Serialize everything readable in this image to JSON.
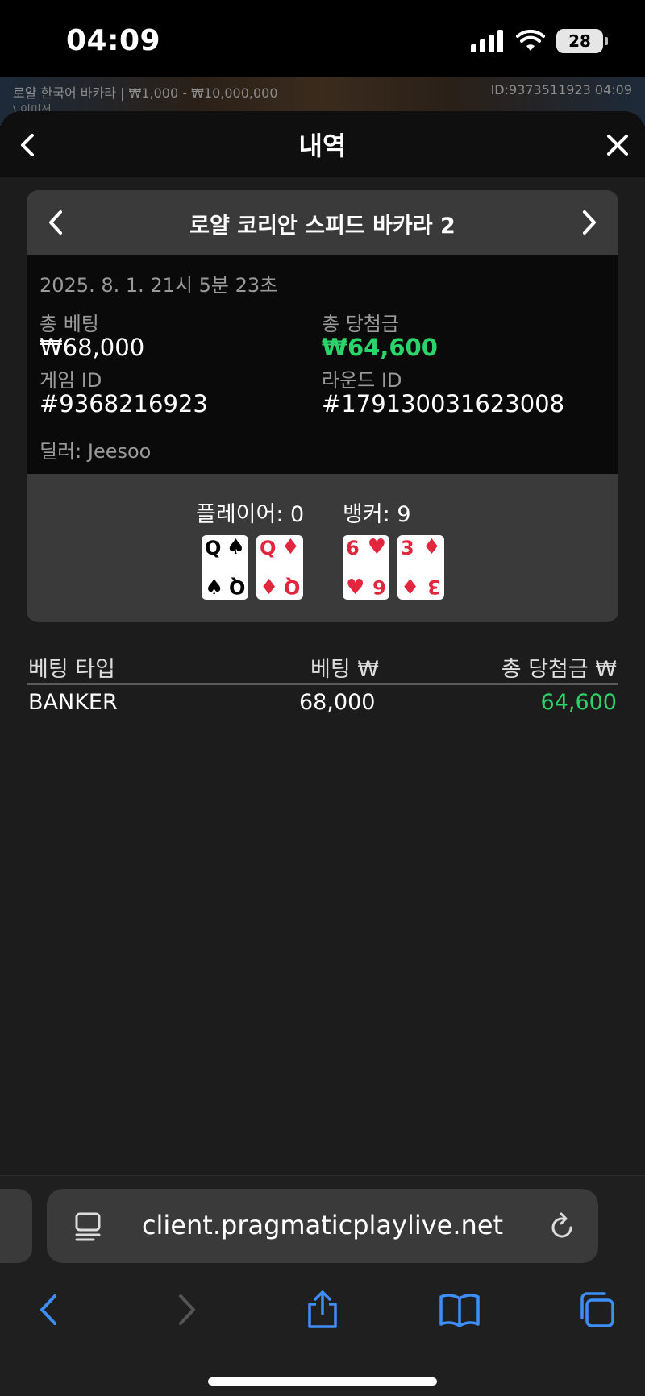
{
  "status_bar": {
    "time": "04:09",
    "battery": "28"
  },
  "game_strip": {
    "left_text": "로얄 한국어 바카라 | ₩1,000 - ₩10,000,000",
    "sub_text": "\\ 이미션",
    "right_text": "ID:9373511923  04:09"
  },
  "header": {
    "title": "내역"
  },
  "card": {
    "title": "로얄 코리안 스피드 바카라 2",
    "date": "2025. 8. 1. 21시 5분 23초",
    "total_bet_label": "총 베팅",
    "total_bet_value": "₩68,000",
    "total_win_label": "총 당첨금",
    "total_win_value": "₩64,600",
    "game_id_label": "게임 ID",
    "game_id_value": "#9368216923",
    "round_id_label": "라운드 ID",
    "round_id_value": "#179130031623008",
    "dealer": "딜러: Jeesoo",
    "player_label": "플레이어: 0",
    "banker_label": "뱅커: 9",
    "player_cards": [
      {
        "rank": "Q",
        "suit": "♠",
        "color": "#000000"
      },
      {
        "rank": "Q",
        "suit": "♦",
        "color": "#e2263d"
      }
    ],
    "banker_cards": [
      {
        "rank": "6",
        "suit": "♥",
        "color": "#e2263d"
      },
      {
        "rank": "3",
        "suit": "♦",
        "color": "#e2263d"
      }
    ]
  },
  "bets_table": {
    "headers": [
      "베팅 타입",
      "베팅 ₩",
      "총 당첨금 ₩"
    ],
    "rows": [
      {
        "type": "BANKER",
        "bet": "68,000",
        "win": "64,600"
      }
    ]
  },
  "browser": {
    "url": "client.pragmaticplaylive.net"
  },
  "colors": {
    "win_green": "#2bd46b",
    "card_red": "#e2263d",
    "safari_blue": "#3d8ef7"
  }
}
